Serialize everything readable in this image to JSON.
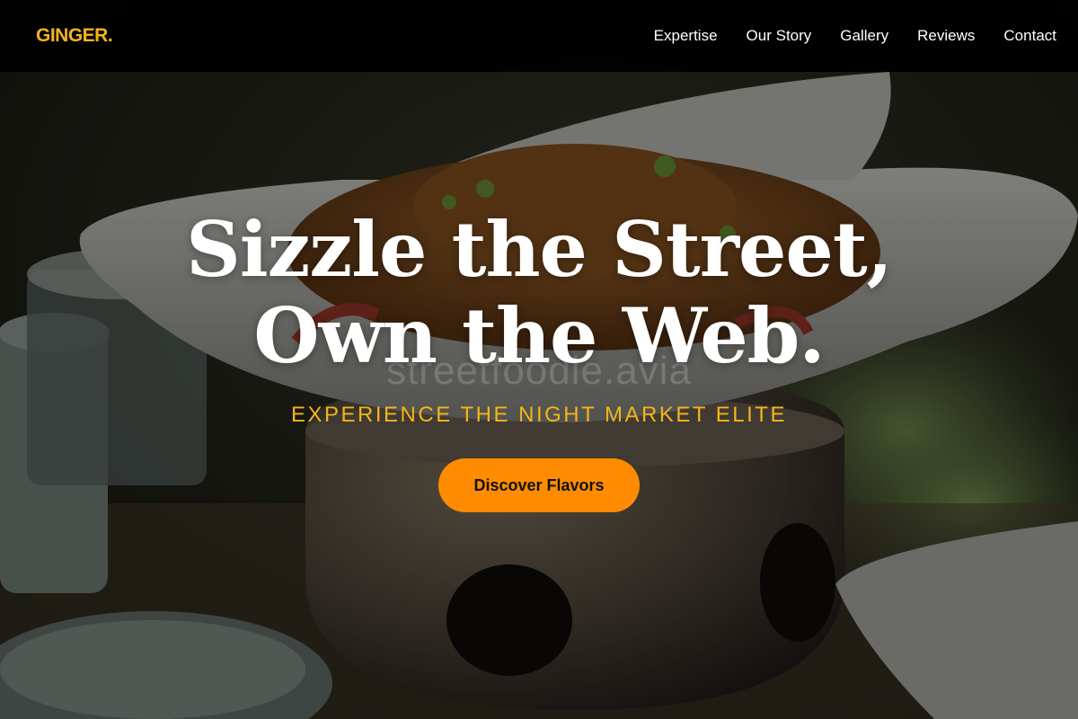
{
  "brand": {
    "name": "GINGER.",
    "accent": "#f4b41a"
  },
  "nav": {
    "items": [
      {
        "label": "Expertise"
      },
      {
        "label": "Our Story"
      },
      {
        "label": "Gallery"
      },
      {
        "label": "Reviews"
      },
      {
        "label": "Contact"
      }
    ]
  },
  "hero": {
    "headline_line1": "Sizzle the Street,",
    "headline_line2": "Own the Web.",
    "watermark": "streetfoodie.avia",
    "tagline": "EXPERIENCE THE NIGHT MARKET ELITE",
    "cta_label": "Discover Flavors",
    "cta_color": "#ff8c00",
    "background_image": "street-food-dish-photo"
  }
}
